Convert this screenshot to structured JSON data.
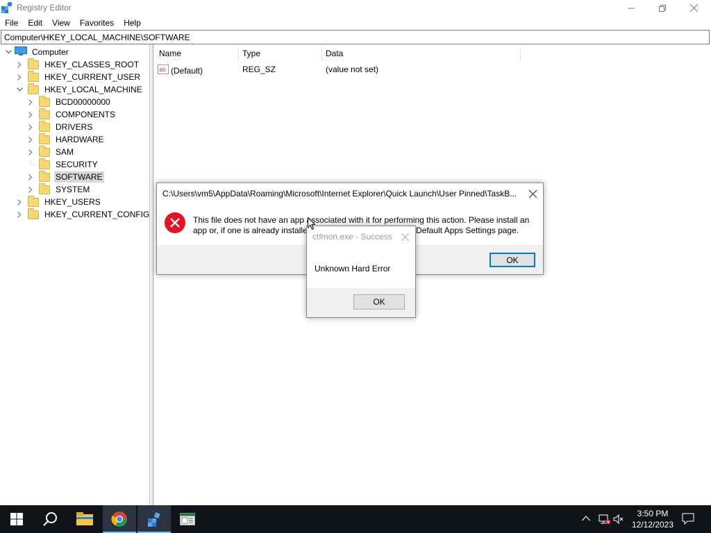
{
  "window": {
    "title": "Registry Editor",
    "controls": {
      "minimize": "—",
      "maximize": "❐",
      "close": "✕"
    }
  },
  "menu": [
    "File",
    "Edit",
    "View",
    "Favorites",
    "Help"
  ],
  "address": "Computer\\HKEY_LOCAL_MACHINE\\SOFTWARE",
  "tree": {
    "root": "Computer",
    "hives": [
      {
        "label": "HKEY_CLASSES_ROOT",
        "expanded": false
      },
      {
        "label": "HKEY_CURRENT_USER",
        "expanded": false
      },
      {
        "label": "HKEY_LOCAL_MACHINE",
        "expanded": true
      },
      {
        "label": "HKEY_USERS",
        "expanded": false
      },
      {
        "label": "HKEY_CURRENT_CONFIG",
        "expanded": false
      }
    ],
    "hklm_children": [
      "BCD00000000",
      "COMPONENTS",
      "DRIVERS",
      "HARDWARE",
      "SAM",
      "SECURITY",
      "SOFTWARE",
      "SYSTEM"
    ],
    "selected": "SOFTWARE"
  },
  "list": {
    "columns": [
      "Name",
      "Type",
      "Data"
    ],
    "rows": [
      {
        "name": "(Default)",
        "type": "REG_SZ",
        "data": "(value not set)"
      }
    ]
  },
  "error_dialog": {
    "title": "C:\\Users\\vm5\\AppData\\Roaming\\Microsoft\\Internet Explorer\\Quick Launch\\User Pinned\\TaskB...",
    "message_line1": "This file does not have an app associated with it for performing this action. Please install an",
    "message_line2_start": "app or, if one is already installe",
    "message_line2_end": "Default Apps Settings page.",
    "ok": "OK",
    "close": "✕"
  },
  "hard_error_dialog": {
    "title": "ctfmon.exe - Success",
    "message": "Unknown Hard Error",
    "ok": "OK",
    "close": "✕"
  },
  "taskbar": {
    "time": "3:50 PM",
    "date": "12/12/2023",
    "tray_chevron": "^"
  },
  "colors": {
    "taskbar_bg": "#101418",
    "accent": "#0078d7",
    "error_red": "#e81123",
    "folder_yellow": "#f7d774"
  }
}
